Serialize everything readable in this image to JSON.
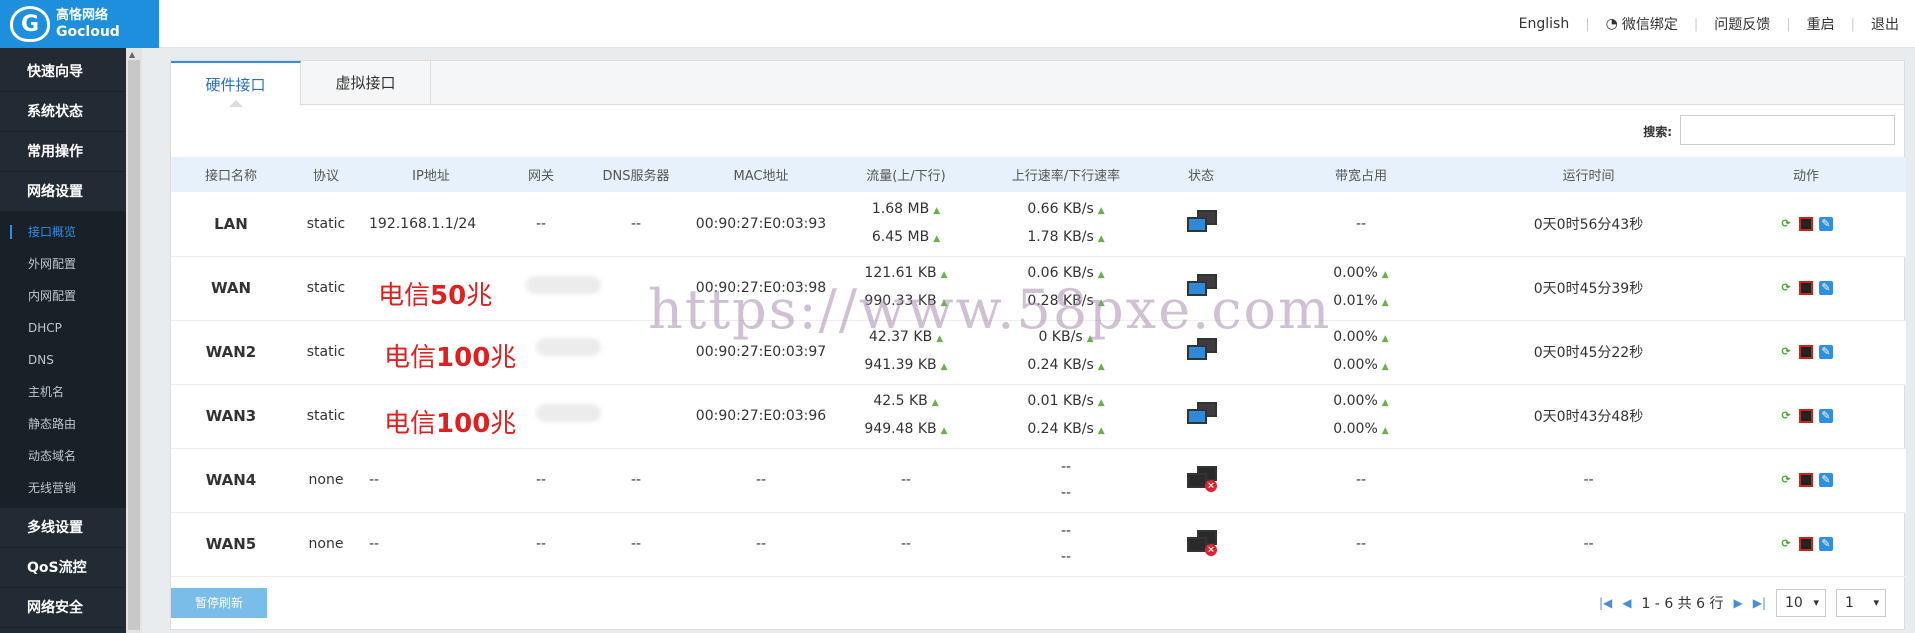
{
  "app": {
    "logo_cn": "高恪网络",
    "logo_en": "Gocloud"
  },
  "topnav": [
    {
      "label": "English"
    },
    {
      "label": "微信绑定"
    },
    {
      "label": "问题反馈"
    },
    {
      "label": "重启"
    },
    {
      "label": "退出"
    }
  ],
  "sidebar": {
    "top_items": [
      "快速向导",
      "系统状态",
      "常用操作",
      "网络设置"
    ],
    "sub_items": [
      "接口概览",
      "外网配置",
      "内网配置",
      "DHCP",
      "DNS",
      "主机名",
      "静态路由",
      "动态域名",
      "无线营销"
    ],
    "bottom_items": [
      "多线设置",
      "QoS流控",
      "网络安全"
    ]
  },
  "tabs": [
    "硬件接口",
    "虚拟接口"
  ],
  "search": {
    "label": "搜索:",
    "placeholder": ""
  },
  "table": {
    "headers": [
      "接口名称",
      "协议",
      "IP地址",
      "网关",
      "DNS服务器",
      "MAC地址",
      "流量(上/下行)",
      "上行速率/下行速率",
      "状态",
      "带宽占用",
      "运行时间",
      "动作"
    ],
    "rows": [
      {
        "name": "LAN",
        "proto": "static",
        "ip": "192.168.1.1/24",
        "gw": "--",
        "dns": "--",
        "mac": "00:90:27:E0:03:93",
        "tx": "1.68 MB",
        "rx": "6.45 MB",
        "up": "0.66 KB/s",
        "down": "1.78 KB/s",
        "status": "up",
        "bw1": "--",
        "bw2": "",
        "uptime": "0天0时56分43秒"
      },
      {
        "name": "WAN",
        "proto": "static",
        "ip": "",
        "gw": "",
        "dns": "",
        "mac": "00:90:27:E0:03:98",
        "tx": "121.61 KB",
        "rx": "990.33 KB",
        "up": "0.06 KB/s",
        "down": "0.28 KB/s",
        "status": "up",
        "bw1": "0.00%",
        "bw2": "0.01%",
        "uptime": "0天0时45分39秒"
      },
      {
        "name": "WAN2",
        "proto": "static",
        "ip": "",
        "gw": "",
        "dns": "",
        "mac": "00:90:27:E0:03:97",
        "tx": "42.37 KB",
        "rx": "941.39 KB",
        "up": "0 KB/s",
        "down": "0.24 KB/s",
        "status": "up",
        "bw1": "0.00%",
        "bw2": "0.00%",
        "uptime": "0天0时45分22秒"
      },
      {
        "name": "WAN3",
        "proto": "static",
        "ip": "",
        "gw": "",
        "dns": "",
        "mac": "00:90:27:E0:03:96",
        "tx": "42.5 KB",
        "rx": "949.48 KB",
        "up": "0.01 KB/s",
        "down": "0.24 KB/s",
        "status": "up",
        "bw1": "0.00%",
        "bw2": "0.00%",
        "uptime": "0天0时43分48秒"
      },
      {
        "name": "WAN4",
        "proto": "none",
        "ip": "--",
        "gw": "--",
        "dns": "--",
        "mac": "--",
        "tx": "--",
        "rx": "",
        "up": "--",
        "down": "--",
        "status": "down",
        "bw1": "--",
        "bw2": "",
        "uptime": "--"
      },
      {
        "name": "WAN5",
        "proto": "none",
        "ip": "--",
        "gw": "--",
        "dns": "--",
        "mac": "--",
        "tx": "--",
        "rx": "",
        "up": "--",
        "down": "--",
        "status": "down",
        "bw1": "--",
        "bw2": "",
        "uptime": "--"
      }
    ]
  },
  "annotations": [
    {
      "pre": "电信",
      "num": "50",
      "post": "兆"
    },
    {
      "pre": "电信",
      "num": "100",
      "post": "兆"
    },
    {
      "pre": "电信",
      "num": "100",
      "post": "兆"
    }
  ],
  "watermark": "https://www.58pxe.com",
  "footer": {
    "pause_label": "暂停刷新",
    "range": "1 - 6 共 6 行",
    "page_size": "10",
    "page": "1"
  }
}
